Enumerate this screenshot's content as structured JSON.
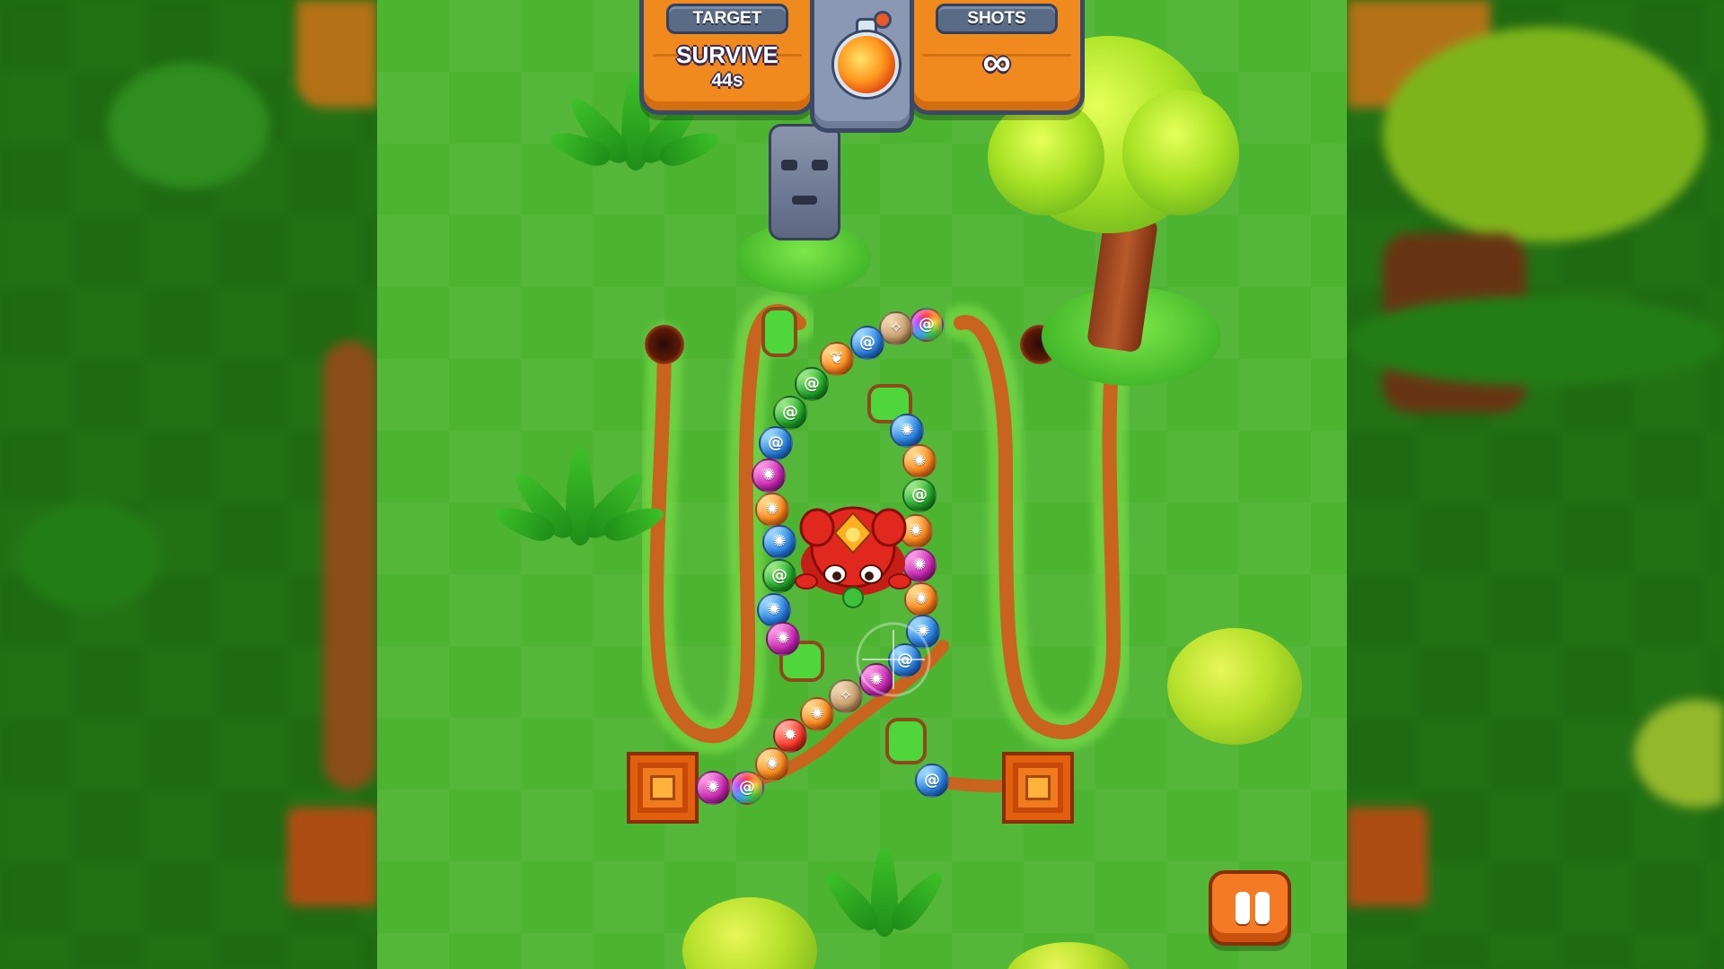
{
  "hud": {
    "target_label": "TARGET",
    "target_value": "SURVIVE",
    "target_time": "44s",
    "shots_label": "SHOTS",
    "shots_value": "∞",
    "power_up_icon": "fire-potion-icon"
  },
  "controls": {
    "pause_icon": "pause-icon"
  },
  "colors": {
    "grass": "#4cb431",
    "track": "#c9641f",
    "hud_orange": "#f08a1e",
    "hud_steel": "#5a6b86",
    "frog_red": "#e0281e"
  },
  "balls": [
    {
      "color": "rainbow",
      "symbol": "swirl"
    },
    {
      "color": "tan",
      "symbol": "crack"
    },
    {
      "color": "blue",
      "symbol": "swirl"
    },
    {
      "color": "orange",
      "symbol": "vine"
    },
    {
      "color": "green",
      "symbol": "swirl"
    },
    {
      "color": "green",
      "symbol": "swirl"
    },
    {
      "color": "blue",
      "symbol": "swirl"
    },
    {
      "color": "magenta",
      "symbol": "sun"
    },
    {
      "color": "orange",
      "symbol": "sun"
    },
    {
      "color": "blue",
      "symbol": "sun"
    },
    {
      "color": "green",
      "symbol": "swirl"
    },
    {
      "color": "blue",
      "symbol": "sun"
    },
    {
      "color": "magenta",
      "symbol": "sun"
    },
    {
      "color": "blue",
      "symbol": "sun"
    },
    {
      "color": "orange",
      "symbol": "sun"
    },
    {
      "color": "green",
      "symbol": "swirl"
    },
    {
      "color": "orange",
      "symbol": "sun"
    },
    {
      "color": "magenta",
      "symbol": "sun"
    },
    {
      "color": "orange",
      "symbol": "sun"
    },
    {
      "color": "blue",
      "symbol": "sun"
    },
    {
      "color": "blue",
      "symbol": "swirl"
    },
    {
      "color": "magenta",
      "symbol": "sun"
    },
    {
      "color": "tan",
      "symbol": "crack"
    },
    {
      "color": "orange",
      "symbol": "sun"
    },
    {
      "color": "red",
      "symbol": "fire"
    },
    {
      "color": "orange",
      "symbol": "sun"
    },
    {
      "color": "rainbow",
      "symbol": "swirl"
    },
    {
      "color": "magenta",
      "symbol": "sun"
    },
    {
      "color": "blue",
      "symbol": "swirl"
    }
  ]
}
